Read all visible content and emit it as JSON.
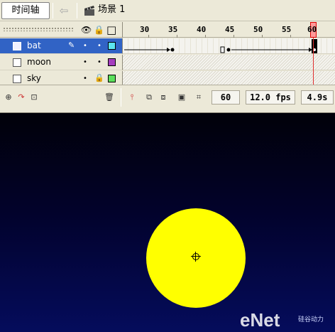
{
  "topbar": {
    "timeline_label": "时间轴",
    "scene_label": "场景 1"
  },
  "header": {
    "eye_icon": "👁",
    "lock_icon": "🔒",
    "outline_icon": "□"
  },
  "ruler": {
    "ticks": [
      "30",
      "35",
      "40",
      "45",
      "50",
      "55",
      "60"
    ],
    "current_frame_marker": "60"
  },
  "layers": [
    {
      "name": "bat",
      "color": "#5ce5f0",
      "selected": true
    },
    {
      "name": "moon",
      "color": "#a63ebf",
      "selected": false
    },
    {
      "name": "sky",
      "color": "#5be05b",
      "selected": false
    }
  ],
  "controls": {
    "current_frame": "60",
    "frame_rate": "12.0 fps",
    "elapsed_time": "4.9s"
  },
  "watermark": {
    "brand": "eNet",
    "sub": "硅谷动力"
  },
  "icons": {
    "back": "back-arrow-icon",
    "scene": "clapper-icon",
    "pencil": "pencil-icon",
    "trash": "trash-icon"
  }
}
